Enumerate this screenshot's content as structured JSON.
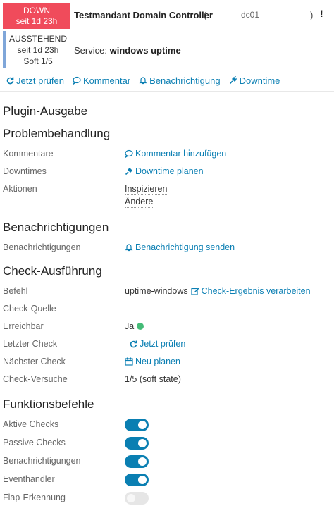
{
  "host": {
    "state": "DOWN",
    "since": "seit 1d 23h",
    "title": "Testmandant Domain Controller",
    "paren_open": "(",
    "address": "dc01",
    "paren_close": ")",
    "flag": "!"
  },
  "service": {
    "state": "AUSSTEHEND",
    "since": "seit 1d 23h",
    "soft": "Soft 1/5",
    "prefix": "Service:",
    "name": "windows uptime"
  },
  "actions": {
    "check_now": "Jetzt prüfen",
    "comment": "Kommentar",
    "notification": "Benachrichtigung",
    "downtime": "Downtime"
  },
  "sections": {
    "plugin_output": "Plugin-Ausgabe",
    "problem": "Problembehandlung",
    "notifications": "Benachrichtigungen",
    "check_exec": "Check-Ausführung",
    "feature_cmds": "Funktionsbefehle"
  },
  "problem": {
    "comments_label": "Kommentare",
    "comments_action": "Kommentar hinzufügen",
    "downtimes_label": "Downtimes",
    "downtimes_action": "Downtime planen",
    "actions_label": "Aktionen",
    "inspect": "Inspizieren",
    "modify": "Ändere"
  },
  "notifications": {
    "label": "Benachrichtigungen",
    "action": "Benachrichtigung senden"
  },
  "check": {
    "command_label": "Befehl",
    "command_value": "uptime-windows",
    "process_result": "Check-Ergebnis verarbeiten",
    "source_label": "Check-Quelle",
    "reachable_label": "Erreichbar",
    "reachable_value": "Ja",
    "last_label": "Letzter Check",
    "last_action": "Jetzt prüfen",
    "next_label": "Nächster Check",
    "next_action": "Neu planen",
    "attempts_label": "Check-Versuche",
    "attempts_value": "1/5 (soft state)"
  },
  "features": [
    {
      "label": "Aktive Checks",
      "enabled": true
    },
    {
      "label": "Passive Checks",
      "enabled": true
    },
    {
      "label": "Benachrichtigungen",
      "enabled": true
    },
    {
      "label": "Eventhandler",
      "enabled": true
    },
    {
      "label": "Flap-Erkennung",
      "enabled": false
    }
  ],
  "colors": {
    "down": "#f04b5b",
    "pending": "#7fa6d9",
    "link": "#0b7fb3",
    "toggle_on": "#0a7fb2",
    "ok_dot": "#44bb77"
  }
}
